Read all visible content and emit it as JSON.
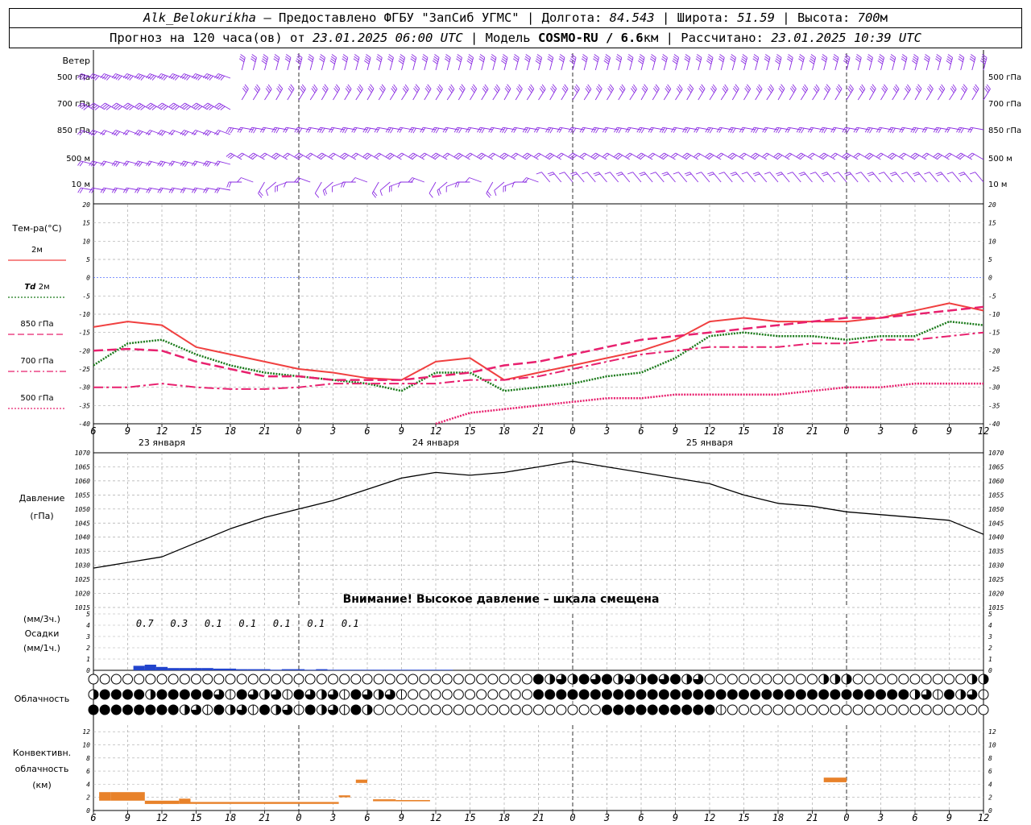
{
  "header": {
    "station": "Alk_Belokurikha",
    "sep1": " – Предоставлено ФГБУ \"ЗапСиб УГМС\" | Долгота: ",
    "lon": "84.543",
    "sep2": " | Широта: ",
    "lat": "51.59",
    "sep3": " | Высота: ",
    "alt": "700",
    "alt_unit": "м",
    "line2_a": "Прогноз на 120 часа(ов) от ",
    "init_time": "23.01.2025 06:00 UTC",
    "line2_b": "  | Модель ",
    "model": "COSMO-RU / 6.6",
    "model_unit": "км",
    "line2_c": " | Рассчитано: ",
    "calc_time": "23.01.2025 10:39 UTC"
  },
  "wind_panel": {
    "title": "Ветер",
    "levels": [
      "500 гПа",
      "700 гПа",
      "850 гПа",
      "500 м",
      "10  м"
    ],
    "color": "#8a2be2"
  },
  "time_axis": {
    "tick_labels": [
      "6",
      "9",
      "12",
      "15",
      "18",
      "21",
      "0",
      "3",
      "6",
      "9",
      "12",
      "15",
      "18",
      "21",
      "0",
      "3",
      "6",
      "9",
      "12",
      "15",
      "18",
      "21",
      "0",
      "3",
      "6",
      "9",
      "12"
    ],
    "day_labels": [
      "23 января",
      "24 января",
      "25 января"
    ]
  },
  "temperature_panel": {
    "title": "Тем-ра(°С)",
    "ylim": [
      -40,
      20
    ],
    "yticks": [
      20,
      15,
      10,
      5,
      0,
      -5,
      -10,
      -15,
      -20,
      -25,
      -30,
      -35,
      -40
    ],
    "legend": [
      {
        "label": "2м",
        "prefix": "",
        "color": "#f04040",
        "dash": "solid"
      },
      {
        "label": "2м",
        "prefix": "Td",
        "color": "#1a7a1a",
        "dash": "dotted"
      },
      {
        "label": "850 гПа",
        "prefix": "",
        "color": "#e8206e",
        "dash": "dash"
      },
      {
        "label": "700 гПа",
        "prefix": "",
        "color": "#e8206e",
        "dash": "dashdot"
      },
      {
        "label": "500 гПа",
        "prefix": "",
        "color": "#e8206e",
        "dash": "dotted"
      }
    ]
  },
  "pressure_panel": {
    "title1": "Давление",
    "title2": "(гПа)",
    "ylim": [
      1015,
      1070
    ],
    "yticks": [
      1070,
      1065,
      1060,
      1055,
      1050,
      1045,
      1040,
      1035,
      1030,
      1025,
      1020,
      1015
    ],
    "warning": "Внимание! Высокое давление – шкала смещена"
  },
  "precip_panel": {
    "title1": "(мм/3ч.)",
    "title2": "Осадки",
    "title3": "(мм/1ч.)",
    "ylim": [
      0,
      5
    ],
    "yticks": [
      5,
      4,
      3,
      2,
      1,
      0
    ],
    "totals_3h": [
      "0.7",
      "0.3",
      "0.1",
      "0.1",
      "0.1",
      "0.1",
      "0.1"
    ],
    "color": "#2244cc"
  },
  "cloud_panel": {
    "title": "Облачность"
  },
  "convective_panel": {
    "title1": "Конвективн.",
    "title2": "облачность",
    "title3": "(км)",
    "ylim": [
      0,
      13
    ],
    "yticks": [
      12,
      10,
      8,
      6,
      4,
      2,
      0
    ],
    "color": "#e8822a"
  },
  "chart_data": [
    {
      "type": "line",
      "name": "temperature",
      "x_hours": [
        0,
        3,
        6,
        9,
        12,
        15,
        18,
        21,
        24,
        27,
        30,
        33,
        36,
        39,
        42,
        45,
        48,
        51,
        54,
        57,
        60,
        63,
        66,
        69,
        72,
        75,
        78
      ],
      "series": [
        {
          "name": "2м",
          "values": [
            -13.5,
            -12,
            -13,
            -19,
            -21,
            -23,
            -25,
            -26,
            -27.5,
            -28,
            -23,
            -22,
            -28,
            -26,
            -24,
            -22,
            -20,
            -17,
            -12,
            -11,
            -12,
            -12,
            -12,
            -11,
            -9,
            -7,
            -9
          ]
        },
        {
          "name": "Td 2м",
          "values": [
            -24,
            -18,
            -17,
            -21,
            -24,
            -26,
            -27,
            -28,
            -29,
            -31,
            -26,
            -26,
            -31,
            -30,
            -29,
            -27,
            -26,
            -22,
            -16,
            -15,
            -16,
            -16,
            -17,
            -16,
            -16,
            -12,
            -13
          ]
        },
        {
          "name": "850 гПа",
          "values": [
            -20,
            -19.5,
            -20,
            -23,
            -25,
            -27,
            -27,
            -28,
            -28,
            -28,
            -27,
            -26,
            -24,
            -23,
            -21,
            -19,
            -17,
            -16,
            -15,
            -14,
            -13,
            -12,
            -11,
            -11,
            -10,
            -9,
            -8
          ]
        },
        {
          "name": "700 гПа",
          "values": [
            -30,
            -30,
            -29,
            -30,
            -30.5,
            -30.5,
            -30,
            -29,
            -29,
            -29,
            -29,
            -28,
            -28,
            -27,
            -25,
            -23,
            -21,
            -20,
            -19,
            -19,
            -19,
            -18,
            -18,
            -17,
            -17,
            -16,
            -15
          ]
        },
        {
          "name": "500 гПа",
          "values": [
            null,
            null,
            null,
            null,
            null,
            null,
            null,
            null,
            null,
            null,
            -40,
            -37,
            -36,
            -35,
            -34,
            -33,
            -33,
            -32,
            -32,
            -32,
            -32,
            -31,
            -30,
            -30,
            -29,
            -29,
            -29
          ]
        }
      ]
    },
    {
      "type": "line",
      "name": "pressure",
      "x_hours": [
        0,
        3,
        6,
        9,
        12,
        15,
        18,
        21,
        24,
        27,
        30,
        33,
        36,
        39,
        42,
        45,
        48,
        51,
        54,
        57,
        60,
        63,
        66,
        69,
        72,
        75,
        78
      ],
      "values": [
        1029,
        1031,
        1033,
        1038,
        1043,
        1047,
        1050,
        1053,
        1057,
        1061,
        1063,
        1062,
        1063,
        1065,
        1067,
        1065,
        1063,
        1061,
        1059,
        1055,
        1052,
        1051,
        1049,
        1048,
        1047,
        1046,
        1041
      ]
    },
    {
      "type": "bar",
      "name": "precipitation_1h",
      "x_hours": [
        4,
        5,
        6,
        7,
        8,
        9,
        10,
        11,
        12,
        13,
        14,
        15,
        16,
        17,
        18,
        19,
        20,
        21,
        22,
        23,
        24,
        25,
        26,
        27,
        28,
        29,
        30,
        31
      ],
      "values": [
        0.4,
        0.5,
        0.3,
        0.2,
        0.2,
        0.2,
        0.2,
        0.15,
        0.15,
        0.1,
        0.1,
        0.1,
        0.05,
        0.1,
        0.1,
        0.05,
        0.1,
        0.05,
        0.05,
        0.05,
        0.05,
        0.05,
        0.05,
        0.05,
        0.05,
        0.05,
        0.05,
        0.05
      ]
    },
    {
      "type": "bar",
      "name": "convective_cloud",
      "segments": [
        {
          "x0": 0.5,
          "x1": 1.5,
          "top": 2.8,
          "base": 1.5
        },
        {
          "x0": 1.5,
          "x1": 4.5,
          "top": 2.8,
          "base": 1.5
        },
        {
          "x0": 4.5,
          "x1": 7.5,
          "top": 1.5,
          "base": 1.0
        },
        {
          "x0": 7.5,
          "x1": 8.5,
          "top": 1.8,
          "base": 1.0
        },
        {
          "x0": 8.5,
          "x1": 21.5,
          "top": 1.3,
          "base": 1.0
        },
        {
          "x0": 21.5,
          "x1": 22.5,
          "top": 2.3,
          "base": 2.0
        },
        {
          "x0": 23.0,
          "x1": 24.0,
          "top": 4.7,
          "base": 4.2
        },
        {
          "x0": 24.5,
          "x1": 26.5,
          "top": 1.7,
          "base": 1.4
        },
        {
          "x0": 26.5,
          "x1": 29.5,
          "top": 1.6,
          "base": 1.4
        },
        {
          "x0": 64.0,
          "x1": 66.0,
          "top": 5.0,
          "base": 4.3
        }
      ]
    }
  ]
}
